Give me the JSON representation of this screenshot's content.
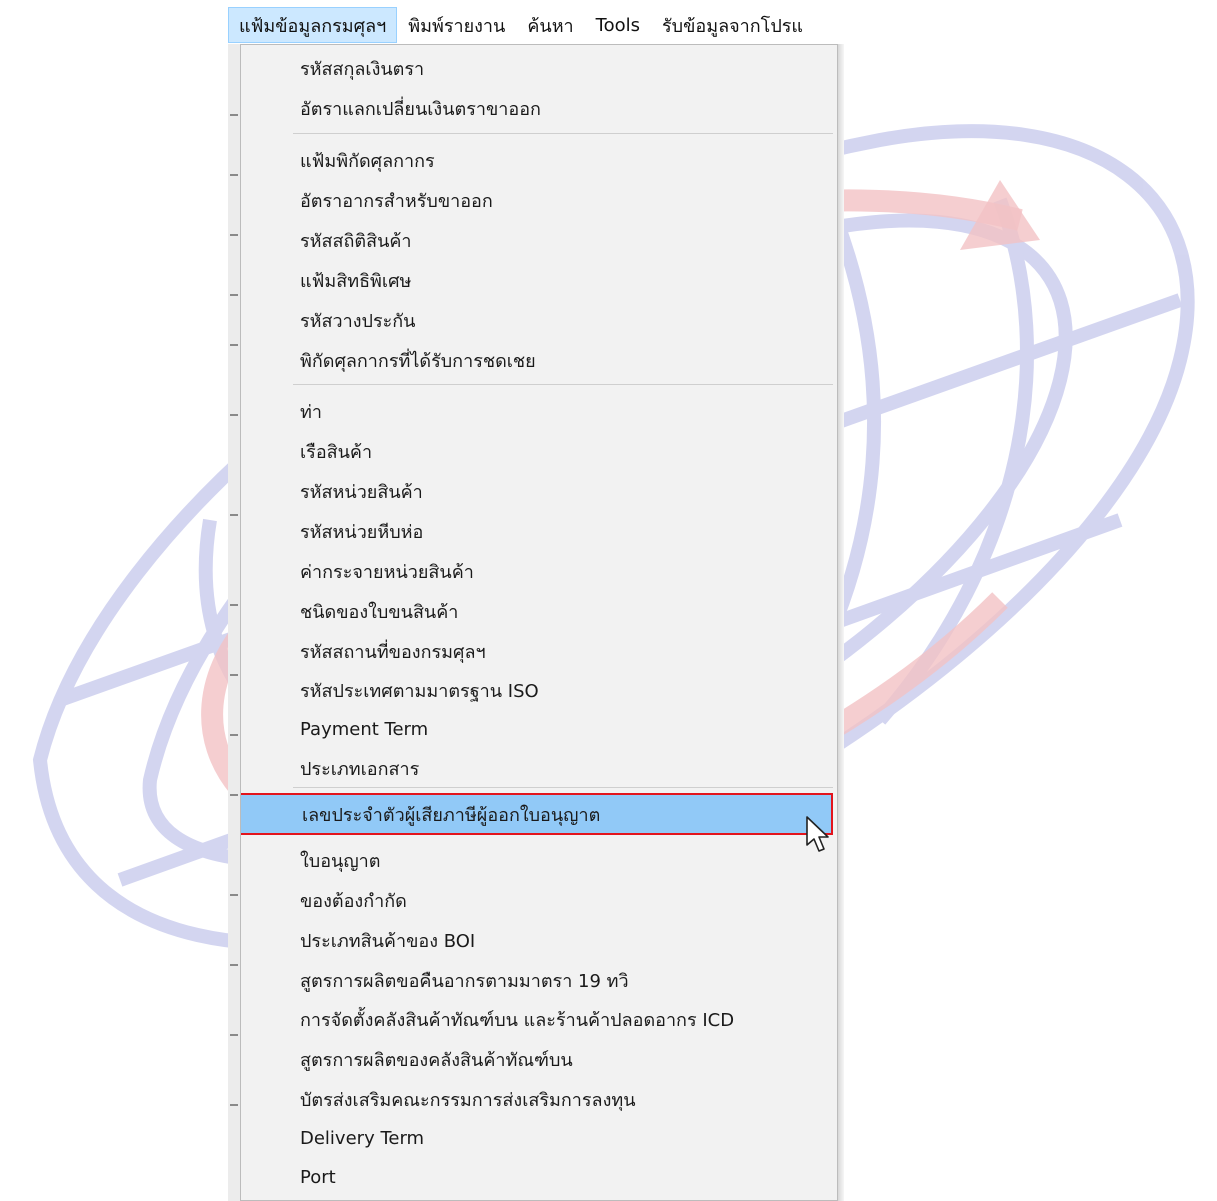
{
  "menubar": {
    "items": [
      {
        "label": "แฟ้มข้อมูลกรมศุลฯ",
        "active": true
      },
      {
        "label": "พิมพ์รายงาน",
        "active": false
      },
      {
        "label": "ค้นหา",
        "active": false
      },
      {
        "label": "Tools",
        "active": false
      },
      {
        "label": "รับข้อมูลจากโปรแ",
        "active": false
      }
    ]
  },
  "dropdown": {
    "items": [
      {
        "label": "รหัสสกุลเงินตรา"
      },
      {
        "label": "อัตราแลกเปลี่ยนเงินตราขาออก"
      },
      {
        "label": "แฟ้มพิกัดศุลกากร"
      },
      {
        "label": "อัตราอากรสำหรับขาออก"
      },
      {
        "label": "รหัสสถิติสินค้า"
      },
      {
        "label": "แฟ้มสิทธิพิเศษ"
      },
      {
        "label": "รหัสวางประกัน"
      },
      {
        "label": "พิกัดศุลกากรที่ได้รับการชดเชย"
      },
      {
        "label": "ท่า"
      },
      {
        "label": "เรือสินค้า"
      },
      {
        "label": "รหัสหน่วยสินค้า"
      },
      {
        "label": "รหัสหน่วยหีบห่อ"
      },
      {
        "label": "ค่ากระจายหน่วยสินค้า"
      },
      {
        "label": "ชนิดของใบขนสินค้า"
      },
      {
        "label": "รหัสสถานที่ของกรมศุลฯ"
      },
      {
        "label": "รหัสประเทศตามมาตรฐาน ISO"
      },
      {
        "label": "Payment Term"
      },
      {
        "label": "ประเภทเอกสาร"
      },
      {
        "label": "เลขประจำตัวผู้เสียภาษีผู้ออกใบอนุญาต",
        "highlighted": true
      },
      {
        "label": "ใบอนุญาต"
      },
      {
        "label": "ของต้องกำกัด"
      },
      {
        "label": "ประเภทสินค้าของ BOI"
      },
      {
        "label": "สูตรการผลิตขอคืนอากรตามมาตรา 19 ทวิ"
      },
      {
        "label": "การจัดตั้งคลังสินค้าทัณฑ์บน และร้านค้าปลอดอากร ICD"
      },
      {
        "label": "สูตรการผลิตของคลังสินค้าทัณฑ์บน"
      },
      {
        "label": "บัตรส่งเสริมคณะกรรมการส่งเสริมการลงทุน"
      },
      {
        "label": "Delivery Term"
      },
      {
        "label": "Port"
      }
    ]
  },
  "icons": {
    "cursor": "mouse-pointer-icon",
    "watermark": "globe-emblem-icon"
  },
  "colors": {
    "highlight_bg": "#91c9f7",
    "highlight_border": "#e3141c",
    "menubar_active_bg": "#cce8ff",
    "menu_bg": "#f2f2f2"
  }
}
